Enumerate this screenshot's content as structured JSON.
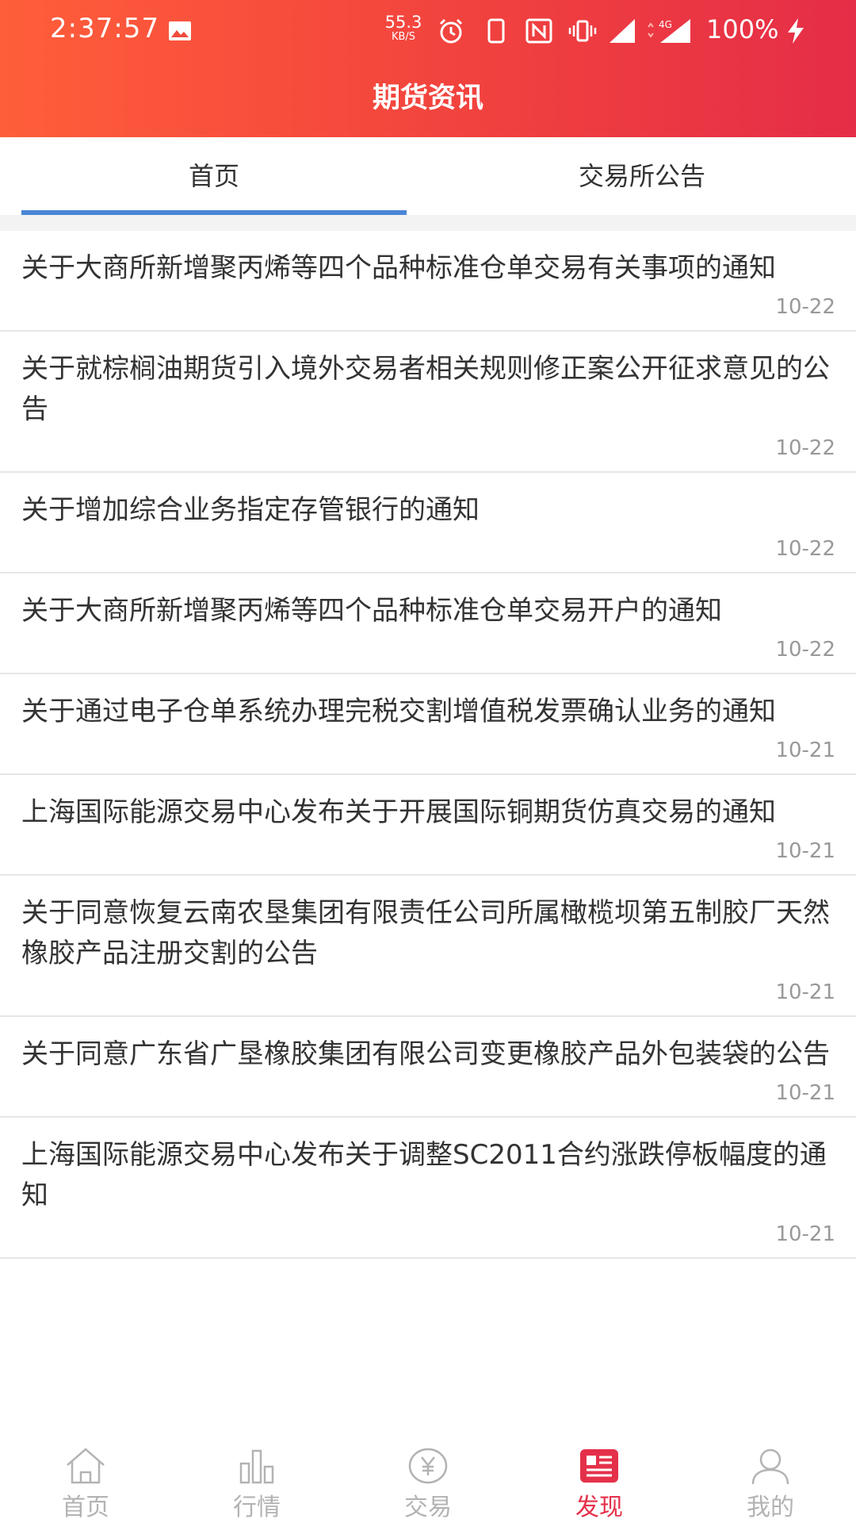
{
  "status_bar": {
    "time": "2:37:57",
    "net_speed": "55.3",
    "net_speed_unit": "KB/S",
    "network_type": "4G",
    "battery": "100%"
  },
  "header": {
    "title": "期货资讯"
  },
  "tabs": [
    {
      "label": "首页",
      "active": true
    },
    {
      "label": "交易所公告",
      "active": false
    }
  ],
  "news": [
    {
      "title": "关于大商所新增聚丙烯等四个品种标准仓单交易有关事项的通知",
      "date": "10-22"
    },
    {
      "title": "关于就棕榈油期货引入境外交易者相关规则修正案公开征求意见的公告",
      "date": "10-22"
    },
    {
      "title": "关于增加综合业务指定存管银行的通知",
      "date": "10-22"
    },
    {
      "title": "关于大商所新增聚丙烯等四个品种标准仓单交易开户的通知",
      "date": "10-22"
    },
    {
      "title": "关于通过电子仓单系统办理完税交割增值税发票确认业务的通知",
      "date": "10-21"
    },
    {
      "title": "上海国际能源交易中心发布关于开展国际铜期货仿真交易的通知",
      "date": "10-21"
    },
    {
      "title": "关于同意恢复云南农垦集团有限责任公司所属橄榄坝第五制胶厂天然橡胶产品注册交割的公告",
      "date": "10-21"
    },
    {
      "title": "关于同意广东省广垦橡胶集团有限公司变更橡胶产品外包装袋的公告",
      "date": "10-21"
    },
    {
      "title": "上海国际能源交易中心发布关于调整SC2011合约涨跌停板幅度的通知",
      "date": "10-21"
    }
  ],
  "bottom_nav": [
    {
      "label": "首页",
      "icon": "home-icon",
      "active": false
    },
    {
      "label": "行情",
      "icon": "market-chart-icon",
      "active": false
    },
    {
      "label": "交易",
      "icon": "yuan-coin-icon",
      "active": false
    },
    {
      "label": "发现",
      "icon": "news-icon",
      "active": true
    },
    {
      "label": "我的",
      "icon": "user-icon",
      "active": false
    }
  ],
  "colors": {
    "header_gradient_start": "#ff5e3a",
    "header_gradient_end": "#e52d47",
    "tab_indicator": "#4a86d6",
    "nav_active": "#e5304a",
    "nav_inactive": "#b3b3b3",
    "date_text": "#999999"
  }
}
